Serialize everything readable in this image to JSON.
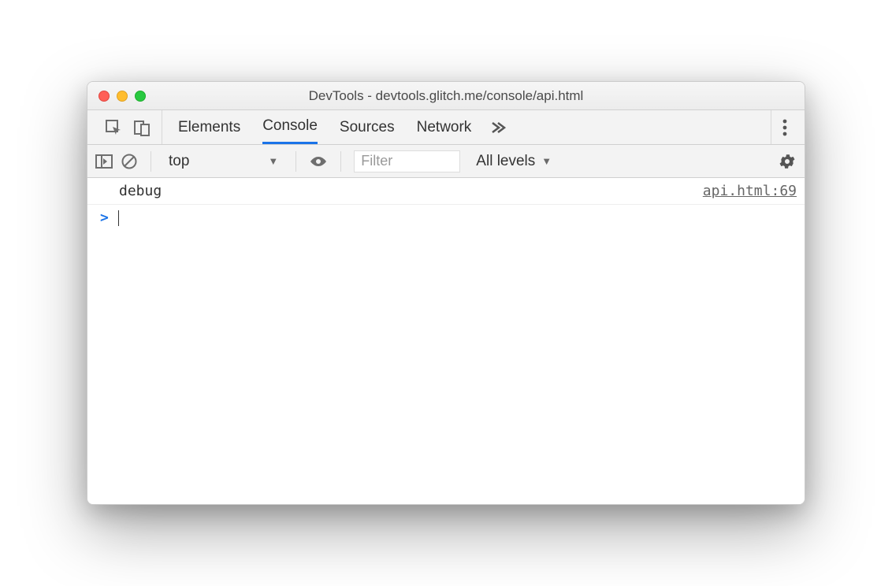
{
  "window": {
    "title": "DevTools - devtools.glitch.me/console/api.html"
  },
  "tabs": {
    "items": [
      "Elements",
      "Console",
      "Sources",
      "Network"
    ],
    "active": "Console"
  },
  "toolbar": {
    "context": "top",
    "filter_placeholder": "Filter",
    "levels_label": "All levels"
  },
  "console": {
    "log": {
      "text": "debug",
      "source": "api.html:69"
    },
    "prompt": ">"
  }
}
